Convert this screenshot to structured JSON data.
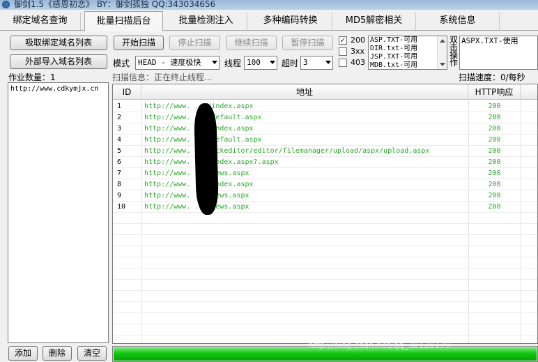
{
  "window": {
    "title": "御剑1.5《感恩初恋》 BY：御剑孤独 QQ:343034656"
  },
  "tabs": [
    {
      "label": "绑定域名查询"
    },
    {
      "label": "批量扫描后台",
      "active": true
    },
    {
      "label": "批量检测注入"
    },
    {
      "label": "多种编码转换"
    },
    {
      "label": "MD5解密相关"
    },
    {
      "label": "系统信息"
    }
  ],
  "left_panel": {
    "import_bound_button": "吸取绑定域名列表",
    "import_external_button": "外部导入域名列表",
    "job_count_label": "作业数量：1",
    "domains": [
      "http://www.cdkymjx.cn"
    ],
    "add_button": "添加",
    "delete_button": "删除",
    "clear_button": "清空"
  },
  "toolbar": {
    "start_button": "开始扫描",
    "stop_button": "停止扫描",
    "continue_button": "继续扫描",
    "pause_button": "暂停扫描",
    "mode_label": "模式",
    "mode_value": "HEAD - 速度极快",
    "threads_label": "线程",
    "threads_value": "100",
    "timeout_label": "超时",
    "timeout_value": "3"
  },
  "status_filters": [
    {
      "label": "200",
      "checked": true
    },
    {
      "label": "3xx",
      "checked": false
    },
    {
      "label": "403",
      "checked": false
    }
  ],
  "dictionaries": [
    "ASP.TXT-可用",
    "DIR.txt-可用",
    "JSP.TXT-可用",
    "MDB.txt-可用"
  ],
  "double_click_label": "双击操作",
  "in_use_dictionary": "ASPX.TXT-使用",
  "scan": {
    "info": "扫描信息：正在终止线程...",
    "speed": "扫描速度：0/每秒",
    "progress_fraction": 1.0
  },
  "results_table": {
    "columns": [
      "ID",
      "地址",
      "HTTP响应"
    ],
    "rows": [
      {
        "id": "1",
        "url": "http://www.          .cn/index.aspx",
        "status": "200"
      },
      {
        "id": "2",
        "url": "http://www.          .cn/default.aspx",
        "status": "200"
      },
      {
        "id": "3",
        "url": "http://www.          .cn/index.aspx",
        "status": "200"
      },
      {
        "id": "4",
        "url": "http://www.          .cn/default.aspx",
        "status": "200"
      },
      {
        "id": "5",
        "url": "http://www.          .cn/fckeditor/editor/filemanager/upload/aspx/upload.aspx",
        "status": "200"
      },
      {
        "id": "6",
        "url": "http://www.          .cn/index.aspx?.aspx",
        "status": "200"
      },
      {
        "id": "7",
        "url": "http://www.          .cn/news.aspx",
        "status": "200"
      },
      {
        "id": "8",
        "url": "http://www.          .cn/index.aspx",
        "status": "200"
      },
      {
        "id": "9",
        "url": "http://www.          .cn/news.aspx",
        "status": "200"
      },
      {
        "id": "10",
        "url": "http://www.          .cn/news.aspx",
        "status": "200"
      }
    ]
  },
  "watermark": "http://blog.csdn.net/qq_38128179"
}
